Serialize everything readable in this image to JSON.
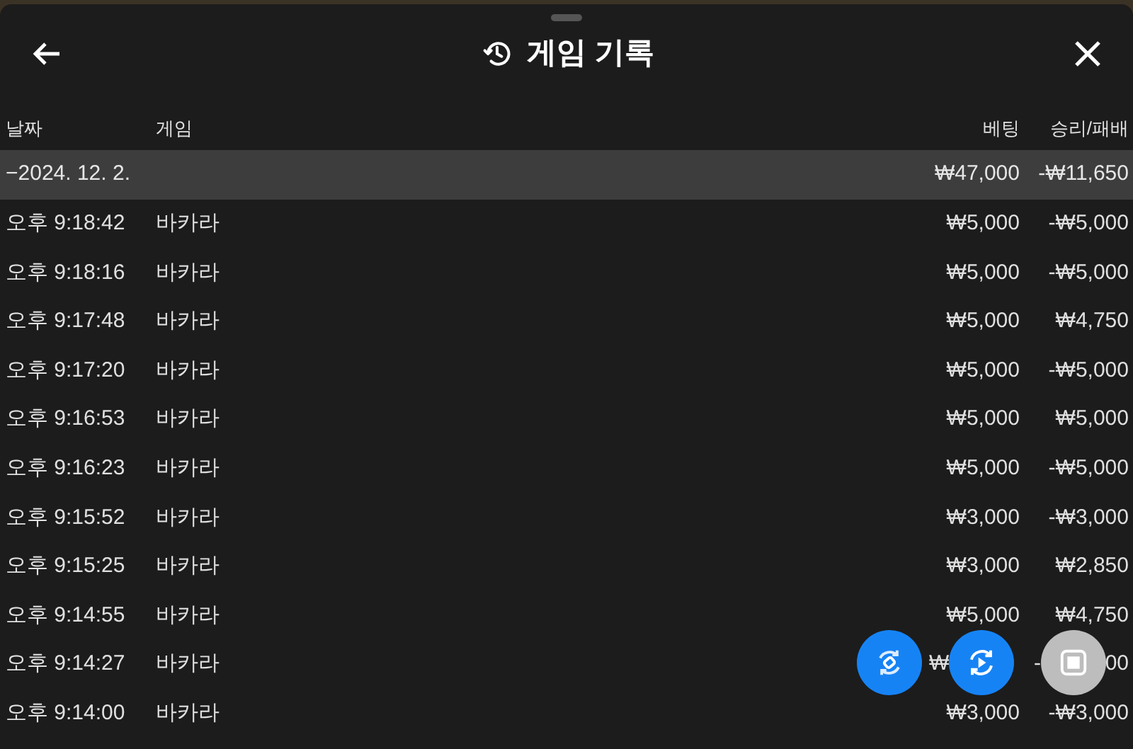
{
  "header": {
    "title": "게임 기록"
  },
  "columns": [
    "날짜",
    "게임",
    "베팅",
    "승리/패배"
  ],
  "group": {
    "toggle": "−",
    "date": "2024. 12. 2.",
    "bet": "₩47,000",
    "result": "-₩11,650"
  },
  "rows": [
    {
      "time": "오후 9:18:42",
      "game": "바카라",
      "bet": "₩5,000",
      "result": "-₩5,000"
    },
    {
      "time": "오후 9:18:16",
      "game": "바카라",
      "bet": "₩5,000",
      "result": "-₩5,000"
    },
    {
      "time": "오후 9:17:48",
      "game": "바카라",
      "bet": "₩5,000",
      "result": "₩4,750"
    },
    {
      "time": "오후 9:17:20",
      "game": "바카라",
      "bet": "₩5,000",
      "result": "-₩5,000"
    },
    {
      "time": "오후 9:16:53",
      "game": "바카라",
      "bet": "₩5,000",
      "result": "₩5,000"
    },
    {
      "time": "오후 9:16:23",
      "game": "바카라",
      "bet": "₩5,000",
      "result": "-₩5,000"
    },
    {
      "time": "오후 9:15:52",
      "game": "바카라",
      "bet": "₩3,000",
      "result": "-₩3,000"
    },
    {
      "time": "오후 9:15:25",
      "game": "바카라",
      "bet": "₩3,000",
      "result": "₩2,850"
    },
    {
      "time": "오후 9:14:55",
      "game": "바카라",
      "bet": "₩5,000",
      "result": "₩4,750"
    },
    {
      "time": "오후 9:14:27",
      "game": "바카라",
      "bet_parts": [
        "₩"
      ],
      "result_parts": [
        "-",
        "00"
      ]
    },
    {
      "time": "오후 9:14:00",
      "game": "바카라",
      "bet": "₩3,000",
      "result": "-₩3,000"
    }
  ],
  "floating_buttons": [
    {
      "kind": "sync"
    },
    {
      "kind": "replay"
    },
    {
      "kind": "stop"
    }
  ]
}
